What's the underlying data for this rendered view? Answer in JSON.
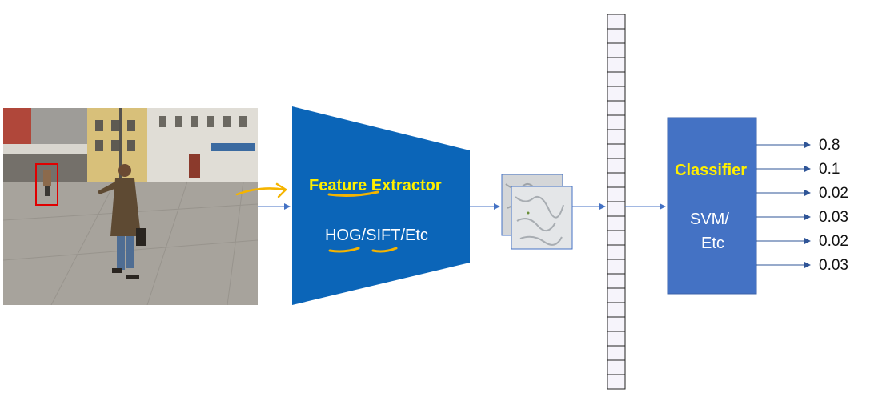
{
  "feature_extractor": {
    "title": "Feature Extractor",
    "methods": "HOG/SIFT/Etc"
  },
  "classifier": {
    "title": "Classifier",
    "method_line1": "SVM/",
    "method_line2": "Etc"
  },
  "outputs": [
    "0.8",
    "0.1",
    "0.02",
    "0.03",
    "0.02",
    "0.03"
  ],
  "colors": {
    "block_blue": "#0b65b8",
    "classifier_blue": "#4472c4",
    "highlight_yellow": "#ffee00",
    "annotation_orange": "#f5b400",
    "detection_box": "#e00000"
  }
}
